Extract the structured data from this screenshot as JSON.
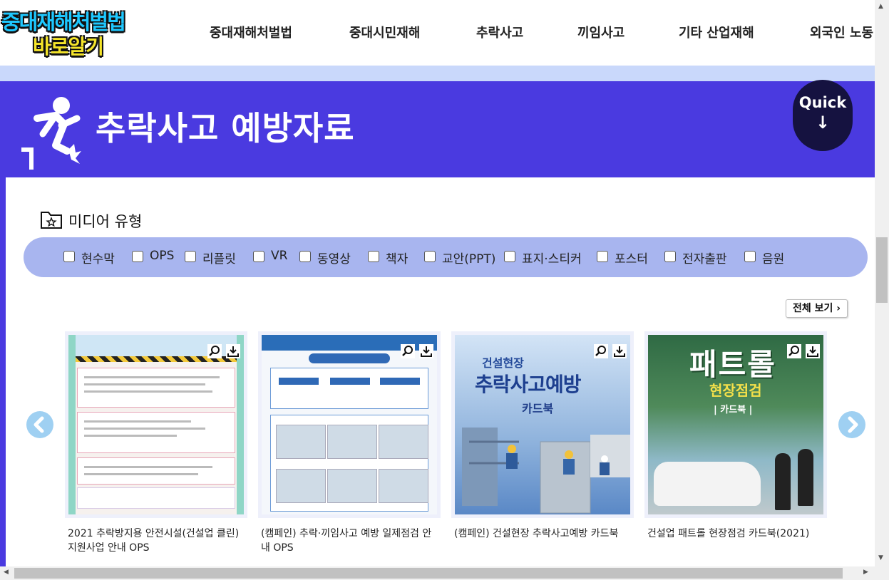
{
  "header": {
    "logo_line1": "중대재해처벌법",
    "logo_line2": "바로알기",
    "nav": [
      {
        "label": "중대재해처벌법"
      },
      {
        "label": "중대시민재해"
      },
      {
        "label": "추락사고"
      },
      {
        "label": "끼임사고"
      },
      {
        "label": "기타 산업재해"
      },
      {
        "label": "외국인 노동"
      }
    ]
  },
  "hero": {
    "title": "추락사고 예방자료",
    "quick_label": "Quick",
    "quick_arrow": "↓"
  },
  "media": {
    "title": "미디어 유형",
    "filters": [
      {
        "label": "현수막"
      },
      {
        "label": "OPS"
      },
      {
        "label": "리플릿"
      },
      {
        "label": "VR"
      },
      {
        "label": "동영상"
      },
      {
        "label": "책자"
      },
      {
        "label": "교안(PPT)"
      },
      {
        "label": "표지·스티커"
      },
      {
        "label": "포스터"
      },
      {
        "label": "전자출판"
      },
      {
        "label": "음원"
      }
    ],
    "view_all": "전체 보기 ›"
  },
  "cards": [
    {
      "title": "2021 추락방지용 안전시설(건설업 클린) 지원사업 안내 OPS"
    },
    {
      "title": "(캠페인) 추락·끼임사고 예방 일제점검 안내 OPS"
    },
    {
      "title": "(캠페인) 건설현장 추락사고예방 카드북",
      "thumb_line1": "건설현장",
      "thumb_line2": "추락사고예방",
      "thumb_line3": "카드북"
    },
    {
      "title": "건설업 패트롤 현장점검 카드북(2021)",
      "thumb_line1": "패트롤",
      "thumb_line2": "현장점검",
      "thumb_line3": "| 카드북 |"
    }
  ],
  "colors": {
    "hero_bg": "#4a3ae0",
    "filter_bar": "#a8b5ef",
    "sub_bar": "#c9d8fb",
    "quick_bg": "#151240",
    "carousel_arrow": "#9fd0f2"
  }
}
